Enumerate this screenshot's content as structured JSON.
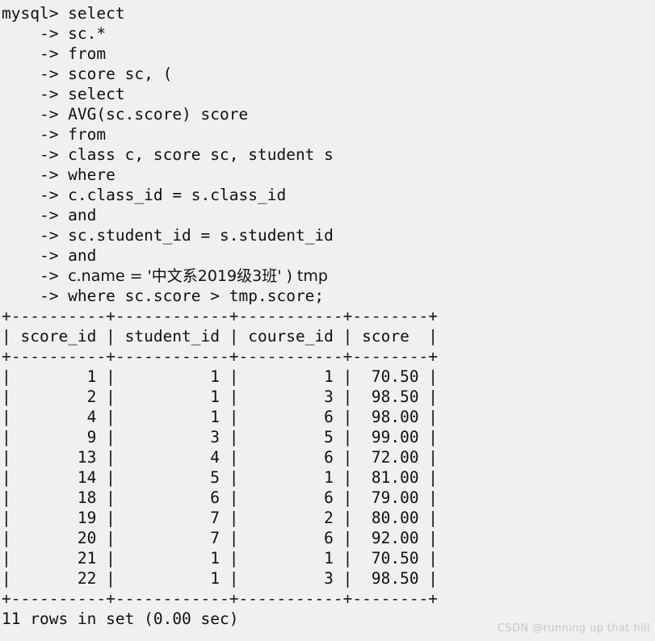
{
  "terminal": {
    "prompt": "mysql>",
    "continuation": "->",
    "query_lines": [
      {
        "prefix": "mysql>",
        "text": "select"
      },
      {
        "prefix": "    ->",
        "text": "sc.*"
      },
      {
        "prefix": "    ->",
        "text": "from"
      },
      {
        "prefix": "    ->",
        "text": "score sc, ("
      },
      {
        "prefix": "    ->",
        "text": "select"
      },
      {
        "prefix": "    ->",
        "text": "AVG(sc.score) score"
      },
      {
        "prefix": "    ->",
        "text": "from"
      },
      {
        "prefix": "    ->",
        "text": "class c, score sc, student s"
      },
      {
        "prefix": "    ->",
        "text": "where"
      },
      {
        "prefix": "    ->",
        "text": "c.class_id = s.class_id"
      },
      {
        "prefix": "    ->",
        "text": "and"
      },
      {
        "prefix": "    ->",
        "text": "sc.student_id = s.student_id"
      },
      {
        "prefix": "    ->",
        "text": "and"
      },
      {
        "prefix": "    ->",
        "text": "c.name = '中文系2019级3班' ) tmp",
        "has_cjk": true
      },
      {
        "prefix": "    ->",
        "text": "where sc.score > tmp.score;"
      }
    ],
    "result_table": {
      "columns": [
        {
          "name": "score_id",
          "width": 10,
          "align": "right"
        },
        {
          "name": "student_id",
          "width": 12,
          "align": "right"
        },
        {
          "name": "course_id",
          "width": 11,
          "align": "right"
        },
        {
          "name": "score",
          "width": 8,
          "align": "right"
        }
      ],
      "rows": [
        [
          "1",
          "1",
          "1",
          "70.50"
        ],
        [
          "2",
          "1",
          "3",
          "98.50"
        ],
        [
          "4",
          "1",
          "6",
          "98.00"
        ],
        [
          "9",
          "3",
          "5",
          "99.00"
        ],
        [
          "13",
          "4",
          "6",
          "72.00"
        ],
        [
          "14",
          "5",
          "1",
          "81.00"
        ],
        [
          "18",
          "6",
          "6",
          "79.00"
        ],
        [
          "19",
          "7",
          "2",
          "80.00"
        ],
        [
          "20",
          "7",
          "6",
          "92.00"
        ],
        [
          "21",
          "1",
          "1",
          "70.50"
        ],
        [
          "22",
          "1",
          "3",
          "98.50"
        ]
      ]
    },
    "status_line": "11 rows in set (0.00 sec)"
  },
  "watermark": "CSDN @running up that hill",
  "colors": {
    "background": "#f0f0f0",
    "text": "#101010",
    "watermark": "#c8c8c8"
  }
}
